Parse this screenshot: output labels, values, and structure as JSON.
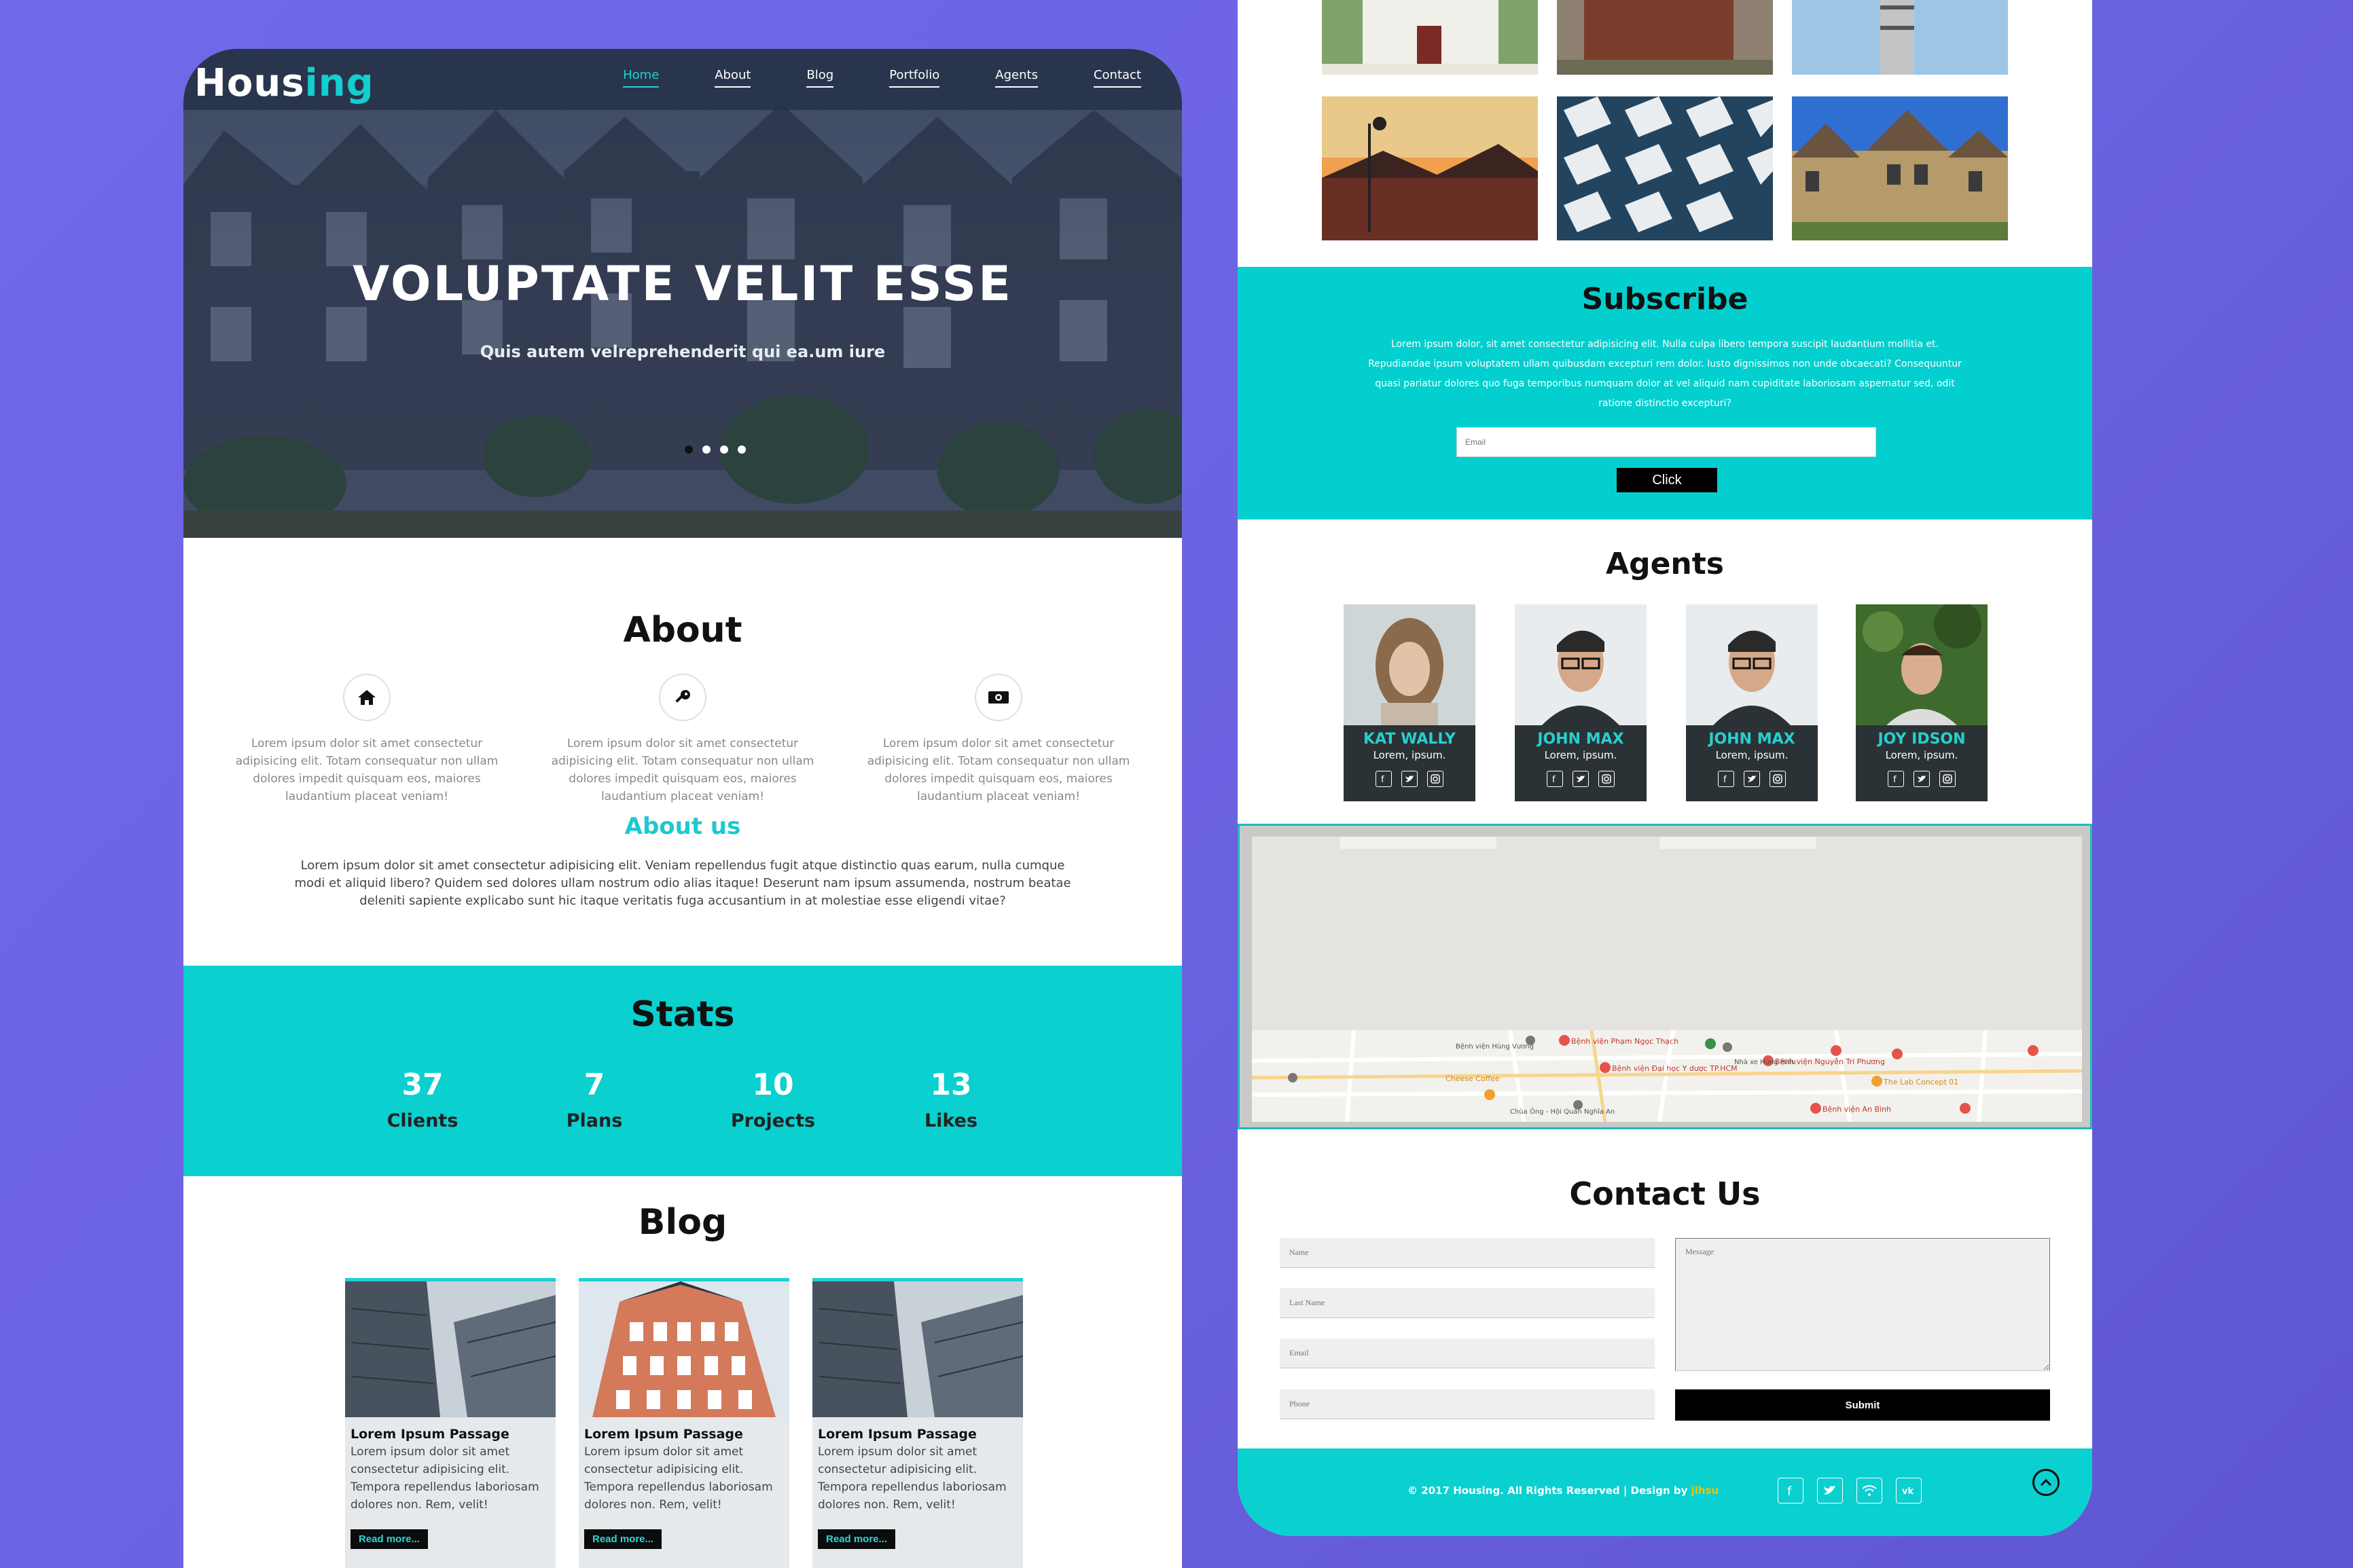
{
  "colors": {
    "accent": "#0ad0d0",
    "background": "#6f66e6",
    "dark": "#2b3236"
  },
  "brand": {
    "name_prefix": "Hous",
    "name_accent": "ing"
  },
  "nav": [
    {
      "label": "Home",
      "active": true
    },
    {
      "label": "About"
    },
    {
      "label": "Blog"
    },
    {
      "label": "Portfolio"
    },
    {
      "label": "Agents"
    },
    {
      "label": "Contact"
    }
  ],
  "hero": {
    "title": "VOLUPTATE VELIT ESSE",
    "subtitle": "Quis autem velreprehenderit qui ea.um iure"
  },
  "about": {
    "title": "About",
    "features": [
      {
        "icon": "home-icon",
        "text": "Lorem ipsum dolor sit amet consectetur adipisicing elit. Totam consequatur non ullam dolores impedit quisquam eos, maiores laudantium placeat veniam!"
      },
      {
        "icon": "key-icon",
        "text": "Lorem ipsum dolor sit amet consectetur adipisicing elit. Totam consequatur non ullam dolores impedit quisquam eos, maiores laudantium placeat veniam!"
      },
      {
        "icon": "money-icon",
        "text": "Lorem ipsum dolor sit amet consectetur adipisicing elit. Totam consequatur non ullam dolores impedit quisquam eos, maiores laudantium placeat veniam!"
      }
    ],
    "us_title": "About us",
    "us_text": "Lorem ipsum dolor sit amet consectetur adipisicing elit. Veniam repellendus fugit atque distinctio quas earum, nulla cumque modi et aliquid libero? Quidem sed dolores ullam nostrum odio alias itaque! Deserunt nam ipsum assumenda, nostrum beatae deleniti sapiente explicabo sunt hic itaque veritatis fuga accusantium in at molestiae esse eligendi vitae?"
  },
  "stats": {
    "title": "Stats",
    "items": [
      {
        "num": "37",
        "label": "Clients"
      },
      {
        "num": "7",
        "label": "Plans"
      },
      {
        "num": "10",
        "label": "Projects"
      },
      {
        "num": "13",
        "label": "Likes"
      }
    ]
  },
  "blog": {
    "title": "Blog",
    "cards": [
      {
        "title": "Lorem Ipsum Passage",
        "text": "Lorem ipsum dolor sit amet consectetur adipisicing elit. Tempora repellendus laboriosam dolores non. Rem, velit!",
        "button": "Read more..."
      },
      {
        "title": "Lorem Ipsum Passage",
        "text": "Lorem ipsum dolor sit amet consectetur adipisicing elit. Tempora repellendus laboriosam dolores non. Rem, velit!",
        "button": "Read more..."
      },
      {
        "title": "Lorem Ipsum Passage",
        "text": "Lorem ipsum dolor sit amet consectetur adipisicing elit. Tempora repellendus laboriosam dolores non. Rem, velit!",
        "button": "Read more..."
      }
    ]
  },
  "subscribe": {
    "title": "Subscribe",
    "text": "Lorem ipsum dolor, sit amet consectetur adipisicing elit. Nulla culpa libero tempora suscipit laudantium mollitia et. Repudiandae ipsum voluptatem ullam quibusdam excepturi rem dolor. Iusto dignissimos non unde obcaecati? Consequuntur quasi pariatur dolores quo fuga temporibus numquam dolor at vel aliquid nam cupiditate laboriosam aspernatur sed, odit ratione distinctio excepturi?",
    "placeholder": "Email",
    "button": "Click"
  },
  "agents": {
    "title": "Agents",
    "items": [
      {
        "name": "KAT WALLY",
        "role": "Lorem, ipsum."
      },
      {
        "name": "JOHN MAX",
        "role": "Lorem, ipsum."
      },
      {
        "name": "JOHN MAX",
        "role": "Lorem, ipsum."
      },
      {
        "name": "JOY IDSON",
        "role": "Lorem, ipsum."
      }
    ]
  },
  "map": {
    "labels": [
      "Bệnh viện Phạm Ngọc Thạch",
      "Bệnh viện Đại học Y dược TP.HCM",
      "Bệnh viện Nguyễn Tri Phương",
      "Bệnh viện An Bình",
      "Cheese Coffee",
      "The Lab Concept 01",
      "Bệnh viện Hùng Vương",
      "Chùa Ông - Hội Quán Nghĩa An",
      "Nhà xe Hùng Hiếu"
    ]
  },
  "contact": {
    "title": "Contact Us",
    "name_ph": "Name",
    "last_ph": "Last Name",
    "email_ph": "Email",
    "phone_ph": "Phone",
    "message_ph": "Message",
    "submit": "Submit"
  },
  "footer": {
    "text": "© 2017 Housing. All Rights Reserved | Design by ",
    "designer": "jlhsu"
  }
}
